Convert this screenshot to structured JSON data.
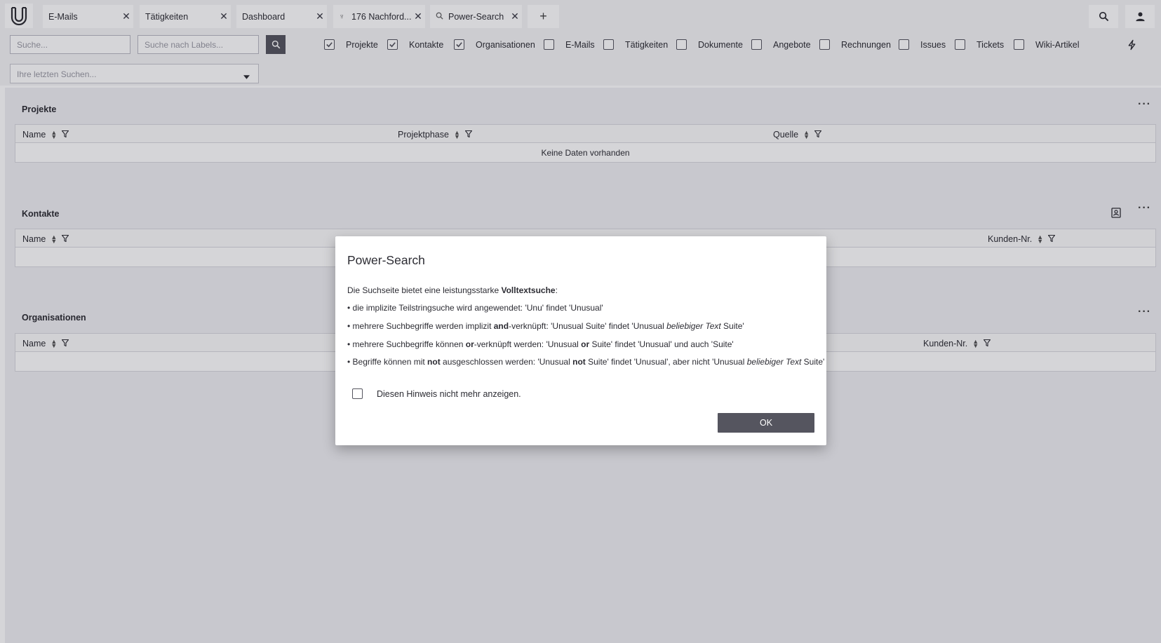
{
  "tabs": [
    {
      "label": "E-Mails",
      "icon": ""
    },
    {
      "label": "Tätigkeiten",
      "icon": ""
    },
    {
      "label": "Dashboard",
      "icon": ""
    },
    {
      "label": "176 Nachford...",
      "icon": "handshake-icon"
    },
    {
      "label": "Power-Search",
      "icon": "search-icon"
    }
  ],
  "add_tab": "+",
  "toolbar": {
    "search_placeholder": "Suche...",
    "labels_placeholder": "Suche nach Labels...",
    "recent_placeholder": "Ihre letzten Suchen...",
    "filters": [
      {
        "label": "Projekte",
        "checked": true
      },
      {
        "label": "Kontakte",
        "checked": true
      },
      {
        "label": "Organisationen",
        "checked": true
      },
      {
        "label": "E-Mails",
        "checked": false
      },
      {
        "label": "Tätigkeiten",
        "checked": false
      },
      {
        "label": "Dokumente",
        "checked": false
      },
      {
        "label": "Angebote",
        "checked": false
      },
      {
        "label": "Rechnungen",
        "checked": false
      },
      {
        "label": "Issues",
        "checked": false
      },
      {
        "label": "Tickets",
        "checked": false
      },
      {
        "label": "Wiki-Artikel",
        "checked": false
      }
    ]
  },
  "sections": {
    "projekte": {
      "title": "Projekte",
      "columns": [
        "Name",
        "Projektphase",
        "Quelle"
      ],
      "empty_text": "Keine Daten vorhanden"
    },
    "kontakte": {
      "title": "Kontakte",
      "columns": [
        "Name",
        "Kunden-Nr."
      ]
    },
    "organisationen": {
      "title": "Organisationen",
      "columns": [
        "Name",
        "Kunden-Nr."
      ]
    }
  },
  "dialog": {
    "title": "Power-Search",
    "intro_prefix": "Die Suchseite bietet eine leistungsstarke ",
    "intro_bold": "Volltextsuche",
    "intro_suffix": ":",
    "b1": "• die implizite Teilstringsuche wird angewendet: 'Unu' findet 'Unusual'",
    "b2_a": "• mehrere Suchbegriffe werden implizit ",
    "b2_bold": "and",
    "b2_b": "-verknüpft: 'Unusual Suite' findet 'Unusual ",
    "b2_italic": "beliebiger Text",
    "b2_c": " Suite'",
    "b3_a": "• mehrere Suchbegriffe können ",
    "b3_bold": "or",
    "b3_b": "-verknüpft werden: 'Unusual ",
    "b3_bold2": "or",
    "b3_c": " Suite' findet 'Unusual' und auch 'Suite'",
    "b4_a": "• Begriffe können mit ",
    "b4_bold": "not",
    "b4_b": " ausgeschlossen werden: 'Unusual ",
    "b4_bold2": "not",
    "b4_c": " Suite' findet 'Unusual', aber nicht 'Unusual ",
    "b4_italic": "beliebiger Text",
    "b4_d": " Suite'",
    "checkbox_label": "Diesen Hinweis nicht mehr anzeigen.",
    "ok_label": "OK"
  }
}
